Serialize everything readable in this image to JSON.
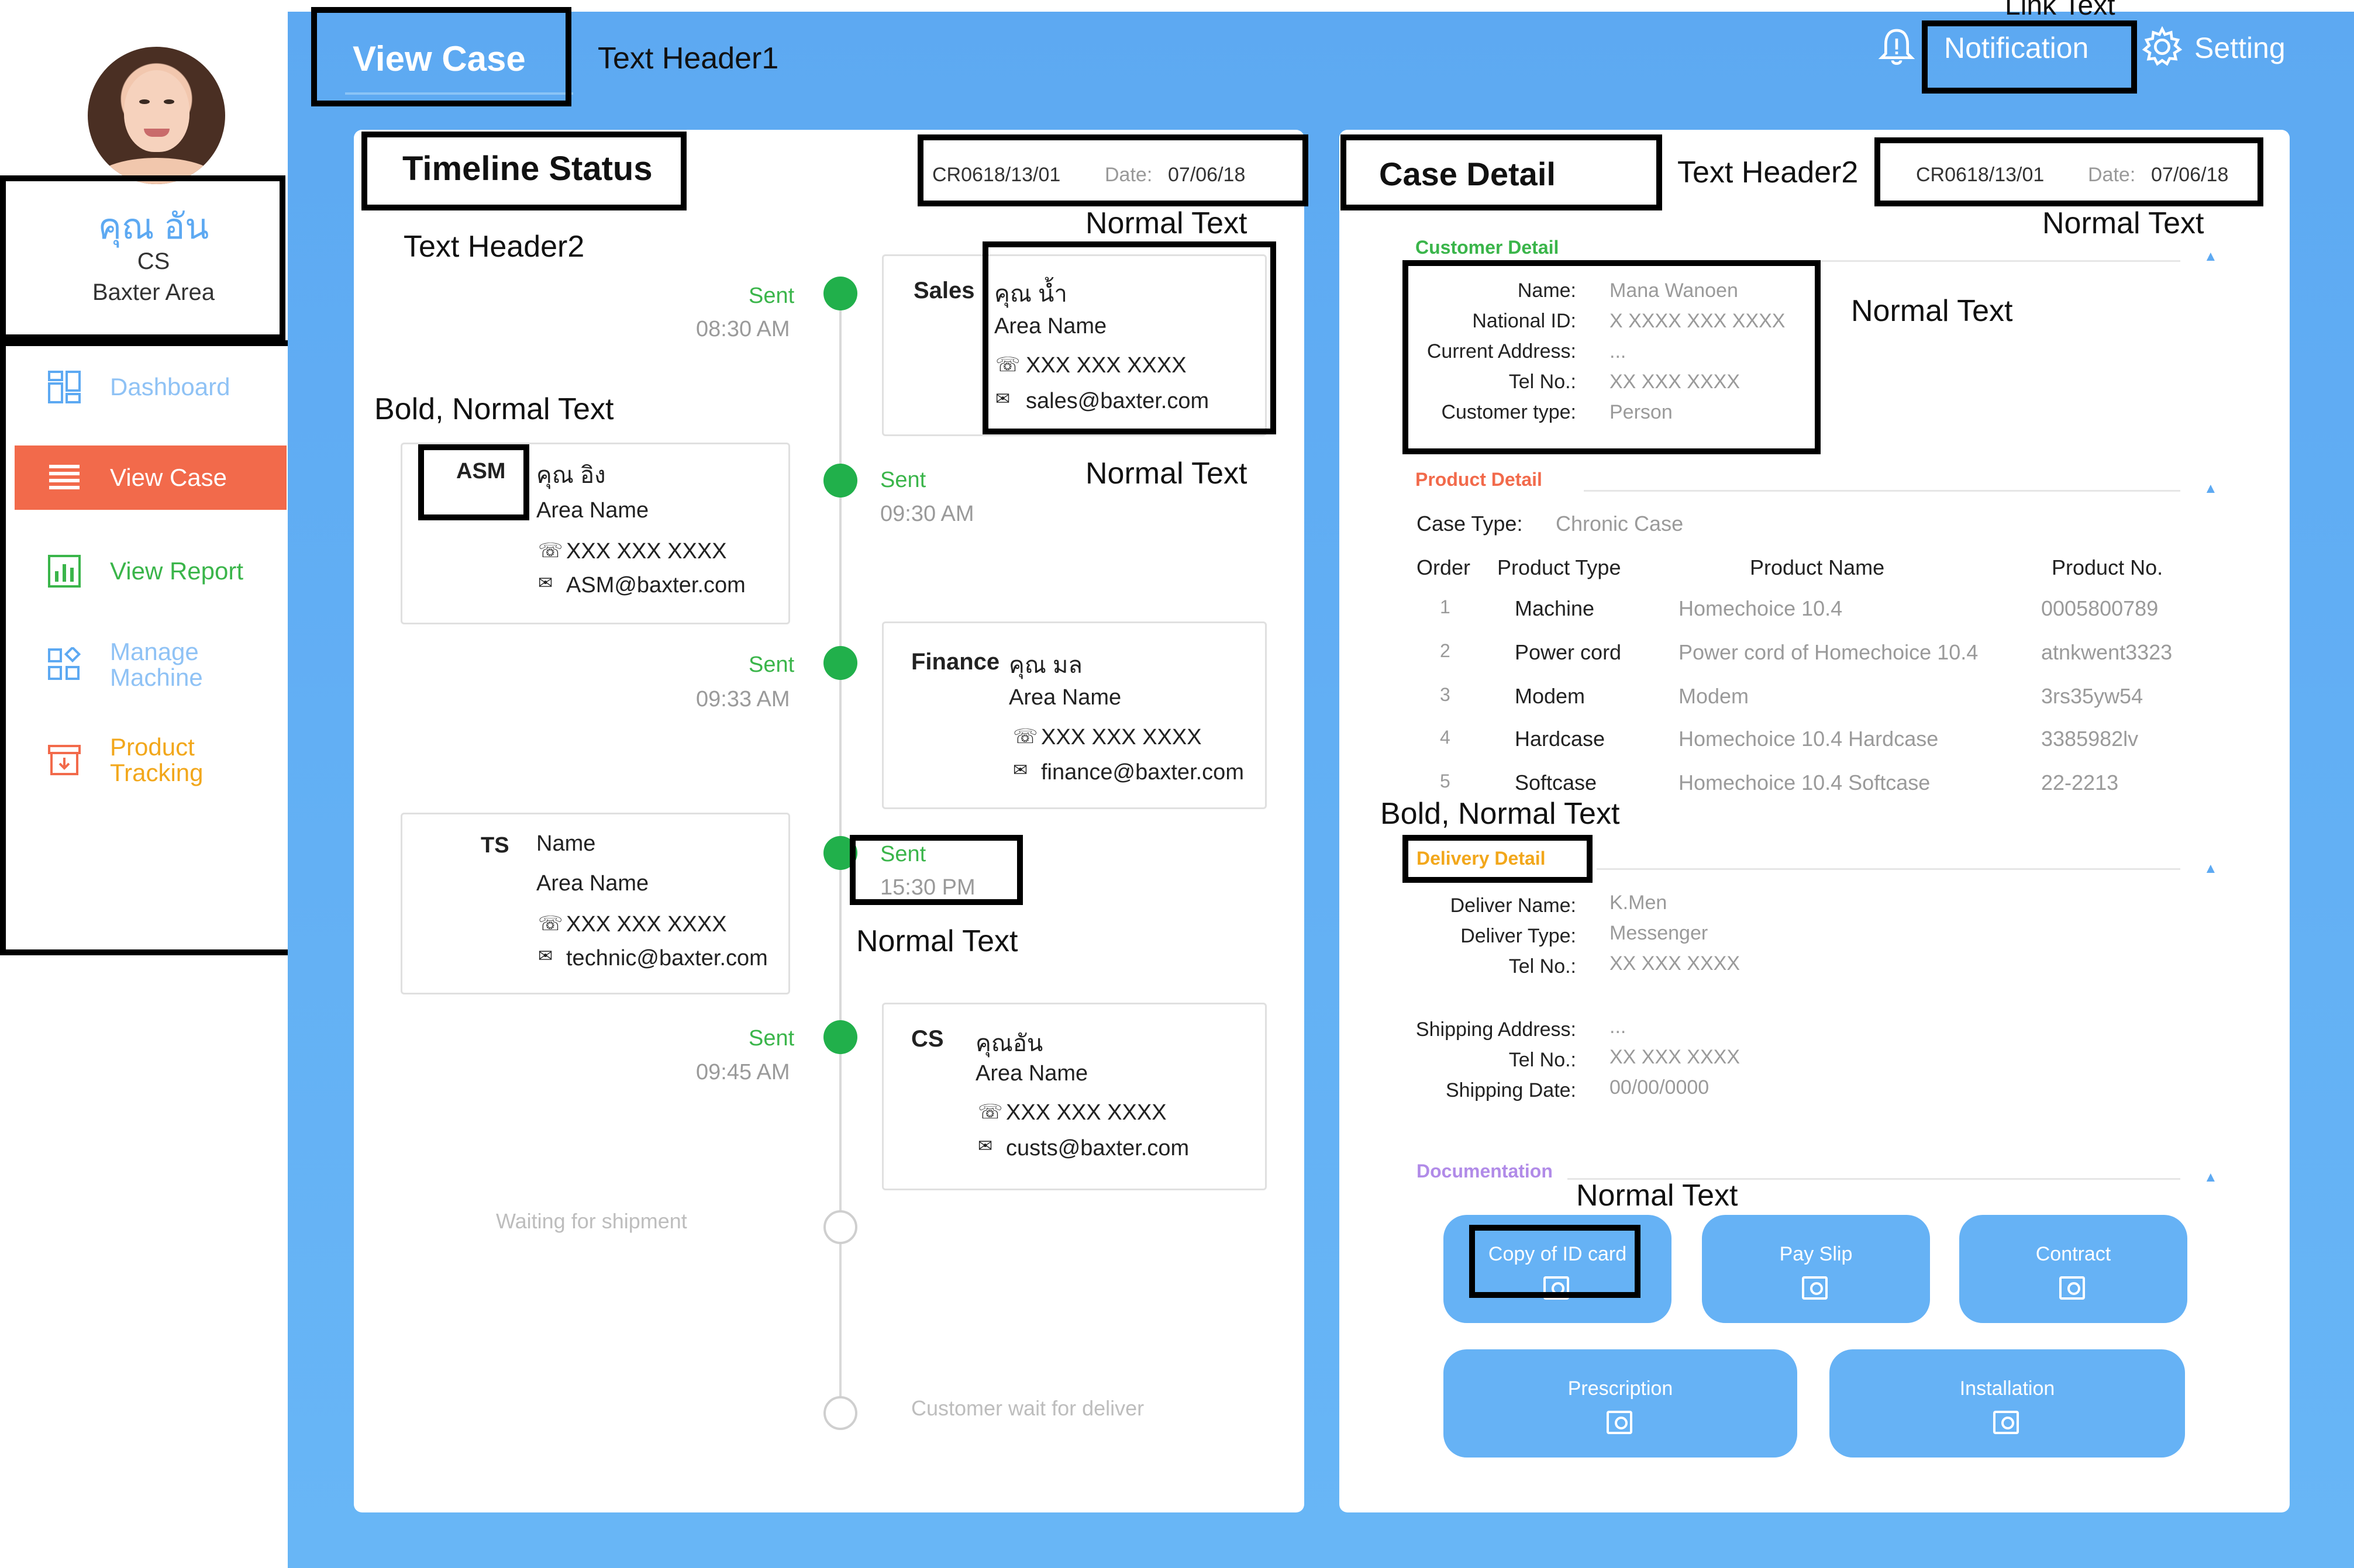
{
  "sidebar": {
    "user": {
      "name": "คุณ อัน",
      "role": "CS",
      "area": "Baxter Area"
    },
    "items": [
      {
        "label": "Dashboard",
        "icon": "dashboard-icon"
      },
      {
        "label": "View Case",
        "icon": "list-icon"
      },
      {
        "label": "View Report",
        "icon": "report-icon"
      },
      {
        "label": "Manage\nMachine",
        "icon": "machine-icon"
      },
      {
        "label": "Product\nTracking",
        "icon": "tracking-icon"
      }
    ],
    "active_index": 1
  },
  "header": {
    "title": "View Case",
    "subtitle": "Text Header1",
    "annotation": "Link Text",
    "notification": "Notification",
    "setting": "Setting"
  },
  "timeline": {
    "title": "Timeline Status",
    "case_no": "CR0618/13/01",
    "date_label": "Date:",
    "date": "07/06/18",
    "annotations": {
      "header2": "Text Header2",
      "normal_1": "Normal Text",
      "bold_normal": "Bold, Normal Text",
      "normal_2": "Normal Text",
      "normal_3": "Normal Text"
    },
    "steps": [
      {
        "status": "Sent",
        "time": "08:30 AM",
        "role": "Sales",
        "name": "คุณ น้ำ",
        "area": "Area Name",
        "phone": "XXX XXX XXXX",
        "email": "sales@baxter.com"
      },
      {
        "status": "Sent",
        "time": "09:30 AM",
        "role": "ASM",
        "name": "คุณ อิง",
        "area": "Area Name",
        "phone": "XXX XXX XXXX",
        "email": "ASM@baxter.com"
      },
      {
        "status": "Sent",
        "time": "09:33 AM",
        "role": "Finance",
        "name": "คุณ มล",
        "area": "Area Name",
        "phone": "XXX XXX XXXX",
        "email": "finance@baxter.com"
      },
      {
        "status": "Sent",
        "time": "15:30 PM",
        "role": "TS",
        "name": "Name",
        "area": "Area Name",
        "phone": "XXX XXX XXXX",
        "email": "technic@baxter.com"
      },
      {
        "status": "Sent",
        "time": "09:45 AM",
        "role": "CS",
        "name": "คุณอัน",
        "area": "Area Name",
        "phone": "XXX XXX XXXX",
        "email": "custs@baxter.com"
      }
    ],
    "pending": [
      "Waiting for shipment",
      "Customer wait for deliver"
    ]
  },
  "case_detail": {
    "title": "Case Detail",
    "header2": "Text Header2",
    "case_no": "CR0618/13/01",
    "date_label": "Date:",
    "date": "07/06/18",
    "annotations": {
      "normal_top": "Normal Text",
      "normal_customer": "Normal Text",
      "bold_normal": "Bold, Normal Text",
      "normal_doc": "Normal Text"
    },
    "customer": {
      "section": "Customer Detail",
      "fields": [
        {
          "label": "Name:",
          "value": "Mana Wanoen"
        },
        {
          "label": "National ID:",
          "value": "X XXXX XXX XXXX"
        },
        {
          "label": "Current Address:",
          "value": "..."
        },
        {
          "label": "Tel No.:",
          "value": "XX XXX XXXX"
        },
        {
          "label": "Customer type:",
          "value": "Person"
        }
      ]
    },
    "product": {
      "section": "Product Detail",
      "case_type_label": "Case Type:",
      "case_type": "Chronic Case",
      "columns": [
        "Order",
        "Product Type",
        "Product Name",
        "Product No."
      ],
      "rows": [
        [
          "1",
          "Machine",
          "Homechoice 10.4",
          "0005800789"
        ],
        [
          "2",
          "Power cord",
          "Power cord of Homechoice 10.4",
          "atnkwent3323"
        ],
        [
          "3",
          "Modem",
          "Modem",
          "3rs35yw54"
        ],
        [
          "4",
          "Hardcase",
          "Homechoice 10.4 Hardcase",
          "3385982lv"
        ],
        [
          "5",
          "Softcase",
          "Homechoice 10.4 Softcase",
          "22-2213"
        ]
      ]
    },
    "delivery": {
      "section": "Delivery Detail",
      "fields": [
        {
          "label": "Deliver Name:",
          "value": "K.Men"
        },
        {
          "label": "Deliver Type:",
          "value": "Messenger"
        },
        {
          "label": "Tel No.:",
          "value": "XX XXX XXXX"
        }
      ],
      "shipping": [
        {
          "label": "Shipping Address:",
          "value": "..."
        },
        {
          "label": "Tel No.:",
          "value": "XX XXX XXXX"
        },
        {
          "label": "Shipping Date:",
          "value": "00/00/0000"
        }
      ]
    },
    "documentation": {
      "section": "Documentation",
      "buttons": [
        "Copy of ID card",
        "Pay Slip",
        "Contract",
        "Prescription",
        "Installation"
      ]
    }
  },
  "colors": {
    "accent": "#f26a4b",
    "main_bg": "#63aff4",
    "green": "#21b04b",
    "customer_section": "#3ab54a",
    "product_section": "#f26a4b",
    "delivery_section": "#f2a71b",
    "documentation_section": "#b18be8"
  }
}
